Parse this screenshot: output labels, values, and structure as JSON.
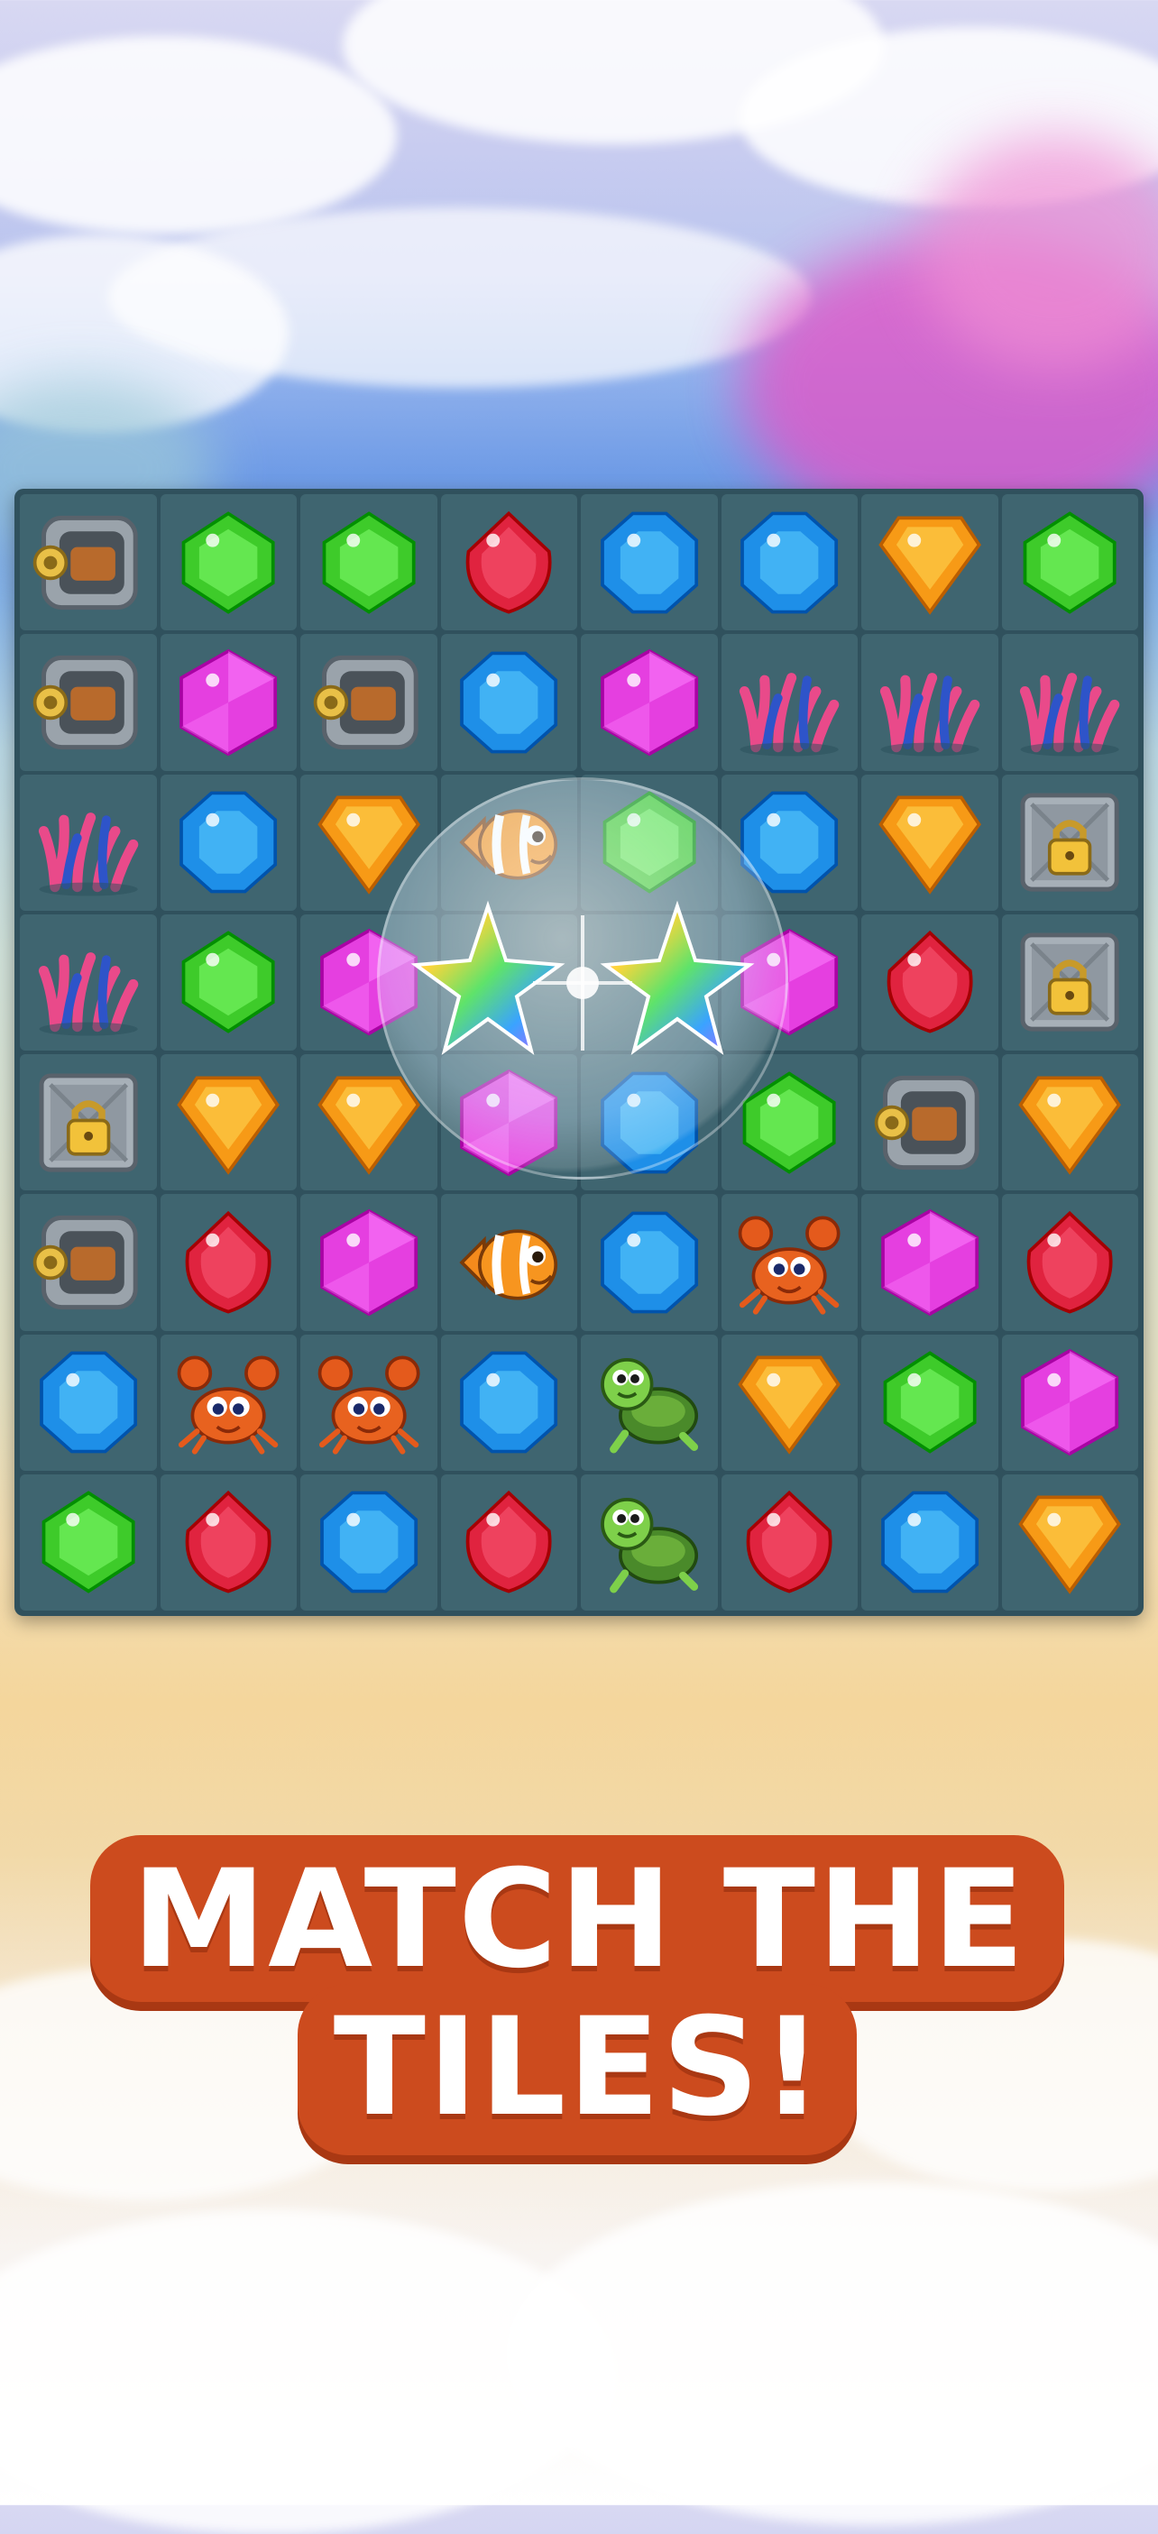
{
  "headline": {
    "line1": "MATCH THE",
    "line2": "TILES!",
    "text_color": "#ffffff",
    "plate_color": "#cc4b1e"
  },
  "board": {
    "rows": 8,
    "cols": 8,
    "background": "#30515d",
    "cell_color": "#3f6570",
    "tiles": [
      [
        "safe",
        "green",
        "green",
        "red",
        "blue",
        "blue",
        "orange",
        "green"
      ],
      [
        "safe",
        "magenta",
        "safe",
        "blue",
        "magenta",
        "coral",
        "coral",
        "coral"
      ],
      [
        "coral",
        "blue",
        "orange",
        "fish",
        "green",
        "blue",
        "orange",
        "lockbox"
      ],
      [
        "coral",
        "green",
        "magenta",
        "rainbow",
        "rainbow",
        "magenta",
        "red",
        "lockbox"
      ],
      [
        "lockbox",
        "orange",
        "orange",
        "magenta",
        "blue",
        "green",
        "safe",
        "orange"
      ],
      [
        "safe",
        "red",
        "magenta",
        "fish",
        "blue",
        "crab",
        "magenta",
        "red"
      ],
      [
        "blue",
        "crab",
        "crab",
        "blue",
        "turtle",
        "orange",
        "green",
        "magenta"
      ],
      [
        "green",
        "red",
        "blue",
        "red",
        "turtle",
        "red",
        "blue",
        "orange"
      ]
    ]
  },
  "colors": {
    "green": "#3ecb2a",
    "red": "#e0233f",
    "blue": "#1e8fe8",
    "orange": "#f79a16",
    "magenta": "#e53fe0"
  },
  "icons": {
    "safe": "safe-icon",
    "coral": "coral-icon",
    "fish": "clownfish-icon",
    "crab": "crab-icon",
    "turtle": "turtle-icon",
    "lockbox": "lockbox-icon",
    "rainbow": "rainbow-gem-icon"
  }
}
